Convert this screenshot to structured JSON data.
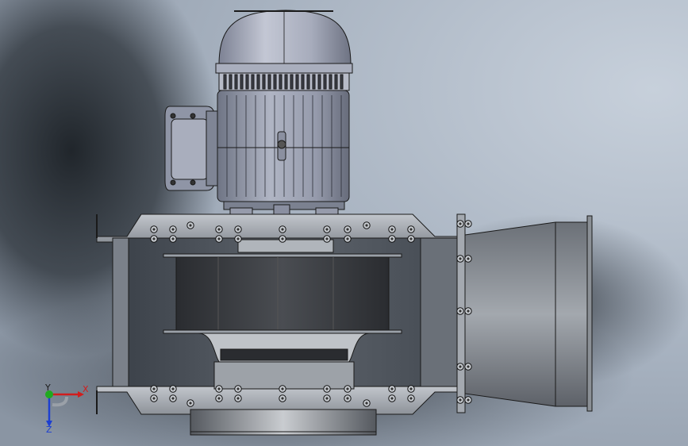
{
  "colors": {
    "background_light": "#b9c4d1",
    "background_dark": "#1c2126",
    "motor_body": "#9ea4b4",
    "steel": "#8e969f",
    "duct": "#7f858c",
    "impeller": "#3a3c40",
    "outline": "#1a1a1a",
    "axis_x": "#d11d1d",
    "axis_y": "#1faa1f",
    "axis_z": "#1d3fd1"
  },
  "triad": {
    "x_label": "X",
    "y_label": "Y",
    "z_label": "Z"
  },
  "icons": [
    "coordinate-triad-icon"
  ]
}
